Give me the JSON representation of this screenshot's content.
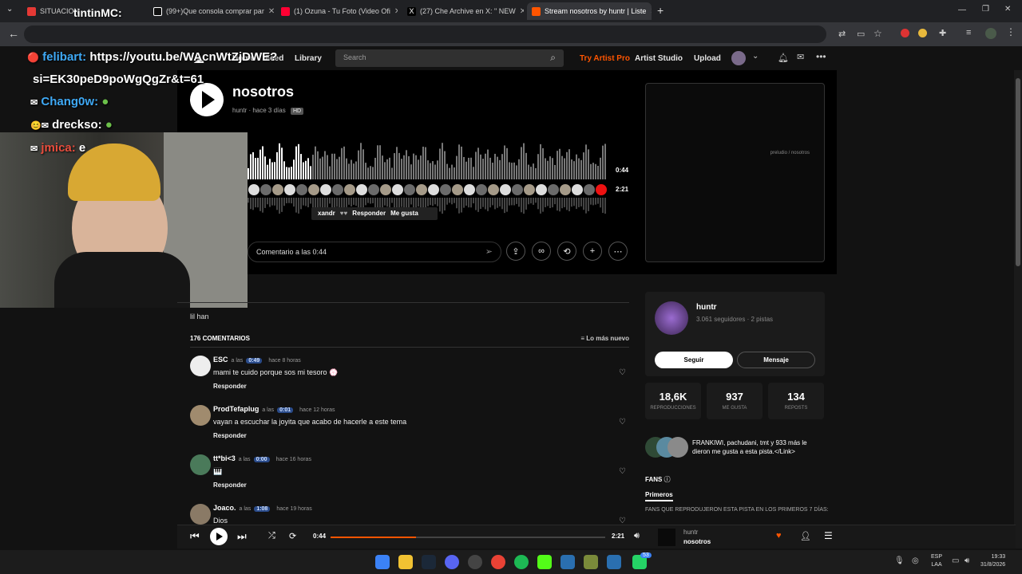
{
  "browser": {
    "tabs": [
      {
        "label": "SITUACION ..."
      },
      {
        "label": "(99+)Que consola comprar par"
      },
      {
        "label": "(1) Ozuna - Tu Foto (Video Ofi"
      },
      {
        "label": "(27) Che Archive en X: \" NEW"
      },
      {
        "label": "Stream nosotros by huntr | Liste"
      }
    ],
    "url_overlay_user": "felibart:",
    "url_overlay_link": "https://youtu.be/WAcnWtZjDWE?",
    "new_tab": "+"
  },
  "chat_overlay": [
    {
      "line": "si=EK30peD9poWgQgZr&t=61"
    },
    {
      "user": "Chang0w:",
      "color": "#3fa9f5"
    },
    {
      "user": "drecksо:",
      "color": "#ffffff"
    },
    {
      "user": "jmica:",
      "text": "e",
      "color": "#e84d3d"
    },
    {
      "user": "tintinMC:",
      "color": "#ffffff"
    }
  ],
  "soundcloud": {
    "nav": {
      "home": "Home",
      "feed": "Feed",
      "library": "Library",
      "search_placeholder": "Search",
      "try_pro": "Try Artist Pro",
      "artist_studio": "Artist Studio",
      "upload": "Upload"
    },
    "track": {
      "title": "nosotros",
      "artist": "huntr",
      "age": "hace 3 días",
      "hd": "HD",
      "time_current": "0:44",
      "time_total": "2:21",
      "art_text": "preludio / nosotros"
    },
    "tooltip": {
      "user": "xandr",
      "reply": "Responder",
      "like": "Me gusta"
    },
    "comment_placeholder": "Comentario a las 0:44",
    "description": "lil han",
    "comments_count": "176 COMENTARIOS",
    "sort": "Lo más nuevo",
    "comments": [
      {
        "user": "ESC",
        "at": "a las",
        "ts": "0:49",
        "ago": "hace 8 horas",
        "text": "mami te cuido porque sos mi tesoro 💮",
        "reply": "Responder",
        "avatar": "#eeeeee"
      },
      {
        "user": "ProdTefaplug",
        "at": "a las",
        "ts": "0:01",
        "ago": "hace 12 horas",
        "text": "vayan a escuchar la joyita que acabo de hacerle a este tema",
        "reply": "Responder",
        "avatar": "#a08b6e"
      },
      {
        "user": "tt*bi<3",
        "at": "a las",
        "ts": "0:00",
        "ago": "hace 16 horas",
        "text": "🎹",
        "reply": "Responder",
        "avatar": "#4a7a5a"
      },
      {
        "user": "Joaco.",
        "at": "a las",
        "ts": "1:08",
        "ago": "hace 19 horas",
        "text": "Dios",
        "reply": "Responder",
        "avatar": "#8a7a66"
      }
    ],
    "artist_card": {
      "name": "huntr",
      "stats": "3.061 seguidores · 2 pistas",
      "follow": "Seguir",
      "message": "Mensaje"
    },
    "stats": [
      {
        "value": "18,6K",
        "label": "REPRODUCCIONES"
      },
      {
        "value": "937",
        "label": "ME GUSTA"
      },
      {
        "value": "134",
        "label": "REPOSTS"
      }
    ],
    "likers": "FRANKIWI, pachudani, tmt y 933 más le dieron me gusta a esta pista.</Link>",
    "fans_title": "FANS",
    "fans_tab": "Primeros",
    "fans_sub": "FANS QUE REPRODUJERON ESTA PISTA EN LOS PRIMEROS 7 DÍAS:"
  },
  "player": {
    "current": "0:44",
    "total": "2:21",
    "artist": "huntr",
    "title": "nosotros",
    "progress": 0.31
  },
  "taskbar": {
    "lang1": "ESP",
    "lang2": "LAA",
    "time": "19:33",
    "date": "31/8/2026",
    "badge": "53"
  }
}
